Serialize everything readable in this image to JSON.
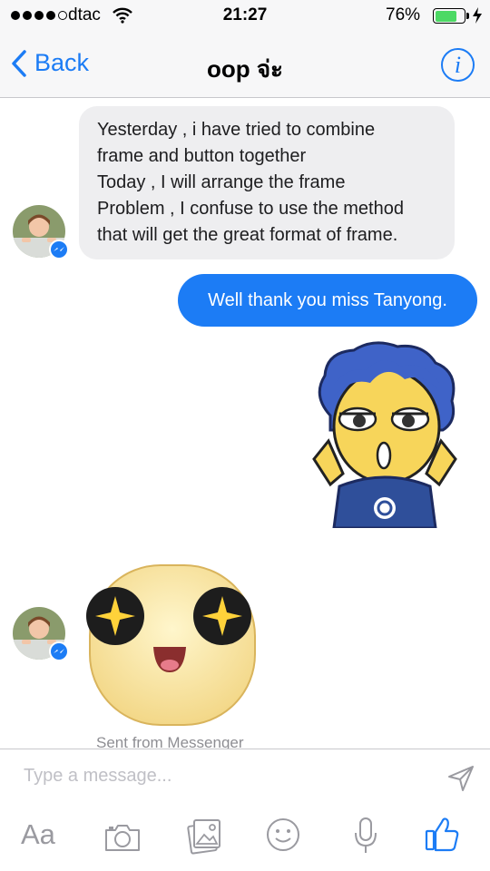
{
  "status_bar": {
    "carrier": "dtac",
    "time": "21:27",
    "battery_percent_label": "76%",
    "battery_level": 0.76,
    "charging_icon": "bolt-icon"
  },
  "nav": {
    "back_label": "Back",
    "title": "oop จ่ะ",
    "info_icon": "i"
  },
  "messages": {
    "incoming_text": [
      "Yesterday , i have tried to combine",
      "frame and button together",
      "Today , I will arrange the frame",
      "Problem , I confuse to use the method",
      "that will get the great format of frame."
    ],
    "outgoing_text": "Well thank you miss Tanyong.",
    "sent_from": "Sent from Messenger"
  },
  "composer": {
    "placeholder": "Type a message...",
    "text_tool_label": "Aa"
  },
  "colors": {
    "accent": "#1c7cf5",
    "incoming_bubble": "#eeeef0",
    "battery": "#4cd964",
    "icon_gray": "#9a9aa0"
  }
}
